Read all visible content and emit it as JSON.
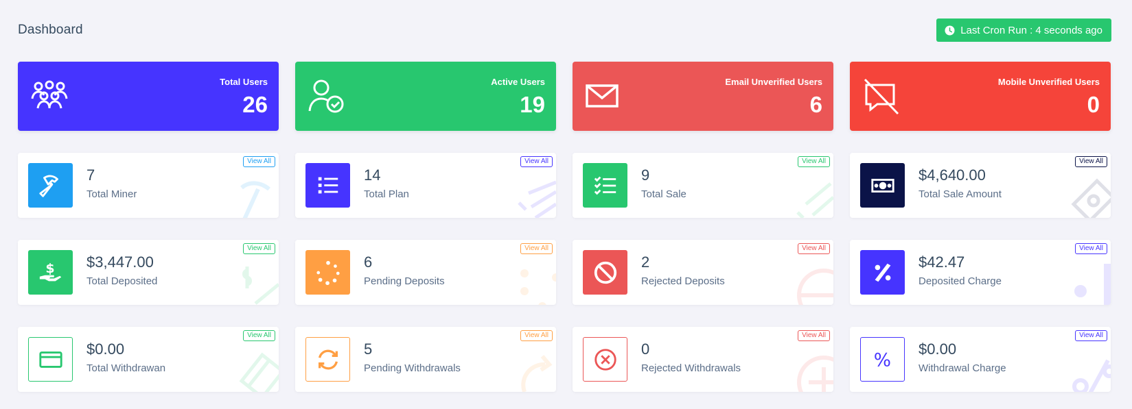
{
  "header": {
    "title": "Dashboard",
    "cron_label": "Last Cron Run : 4 seconds ago"
  },
  "colors": {
    "blue": "#4634ff",
    "green": "#28c76f",
    "coral": "#eb5656",
    "red": "#f5443a",
    "sky": "#1e9ff2",
    "navy": "#0b1348",
    "orange": "#ff9f43",
    "dark": "#34495e"
  },
  "stats": [
    {
      "label": "Total Users",
      "value": "26",
      "icon": "users-icon"
    },
    {
      "label": "Active Users",
      "value": "19",
      "icon": "user-check-icon"
    },
    {
      "label": "Email Unverified Users",
      "value": "6",
      "icon": "envelope-icon"
    },
    {
      "label": "Mobile Unverified Users",
      "value": "0",
      "icon": "mobile-off-icon"
    }
  ],
  "widgets": [
    {
      "amount": "7",
      "title": "Total Miner",
      "icon": "hammer-icon",
      "view_all": "View All"
    },
    {
      "amount": "14",
      "title": "Total Plan",
      "icon": "list-icon",
      "view_all": "View All"
    },
    {
      "amount": "9",
      "title": "Total Sale",
      "icon": "checklist-icon",
      "view_all": "View All"
    },
    {
      "amount": "$4,640.00",
      "title": "Total Sale Amount",
      "icon": "money-bill-icon",
      "view_all": "View All"
    },
    {
      "amount": "$3,447.00",
      "title": "Total Deposited",
      "icon": "hand-dollar-icon",
      "view_all": "View All"
    },
    {
      "amount": "6",
      "title": "Pending Deposits",
      "icon": "spinner-icon",
      "view_all": "View All"
    },
    {
      "amount": "2",
      "title": "Rejected Deposits",
      "icon": "ban-icon",
      "view_all": "View All"
    },
    {
      "amount": "$42.47",
      "title": "Deposited Charge",
      "icon": "percent-icon",
      "view_all": "View All"
    },
    {
      "amount": "$0.00",
      "title": "Total Withdrawan",
      "icon": "credit-card-icon",
      "view_all": "View All"
    },
    {
      "amount": "5",
      "title": "Pending Withdrawals",
      "icon": "sync-icon",
      "view_all": "View All"
    },
    {
      "amount": "0",
      "title": "Rejected Withdrawals",
      "icon": "times-circle-icon",
      "view_all": "View All"
    },
    {
      "amount": "$0.00",
      "title": "Withdrawal Charge",
      "icon": "percent-icon",
      "view_all": "View All"
    }
  ]
}
